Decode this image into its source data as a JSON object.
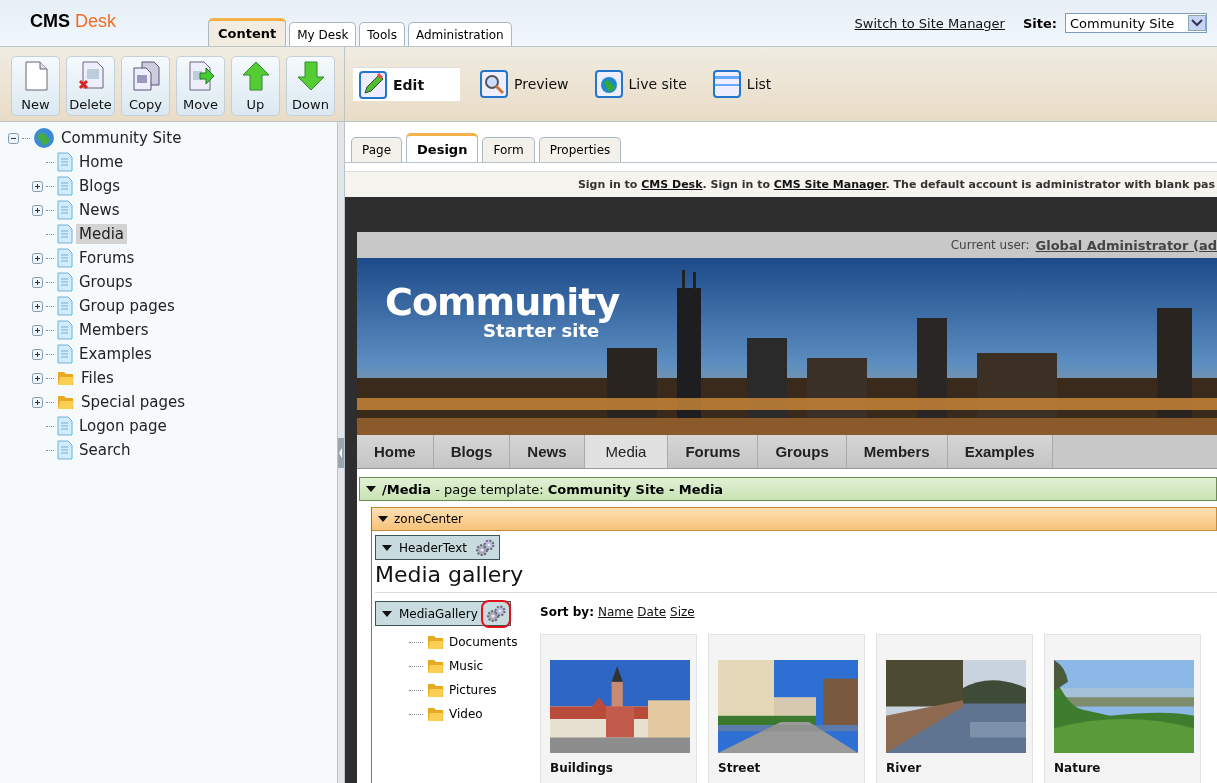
{
  "logo": {
    "main": "CMS",
    "accent": "Desk"
  },
  "main_tabs": [
    {
      "label": "Content",
      "selected": true
    },
    {
      "label": "My Desk",
      "selected": false
    },
    {
      "label": "Tools",
      "selected": false
    },
    {
      "label": "Administration",
      "selected": false
    }
  ],
  "switch_link": "Switch to Site Manager",
  "site_label": "Site:",
  "site_select": "Community Site",
  "toolbar": [
    {
      "label": "New",
      "kind": "new"
    },
    {
      "label": "Delete",
      "kind": "delete"
    },
    {
      "label": "Copy",
      "kind": "copy"
    },
    {
      "label": "Move",
      "kind": "move"
    },
    {
      "label": "Up",
      "kind": "up"
    },
    {
      "label": "Down",
      "kind": "down"
    }
  ],
  "view_modes": [
    {
      "label": "Edit",
      "kind": "edit",
      "selected": true
    },
    {
      "label": "Preview",
      "kind": "preview",
      "selected": false
    },
    {
      "label": "Live site",
      "kind": "live",
      "selected": false
    },
    {
      "label": "List",
      "kind": "list",
      "selected": false
    }
  ],
  "tree": [
    {
      "label": "Community Site",
      "kind": "site",
      "expandable": true,
      "expanded": true,
      "selected": false,
      "children": [
        {
          "label": "Home",
          "kind": "page",
          "expandable": false,
          "selected": false
        },
        {
          "label": "Blogs",
          "kind": "page",
          "expandable": true,
          "selected": false
        },
        {
          "label": "News",
          "kind": "page",
          "expandable": true,
          "selected": false
        },
        {
          "label": "Media",
          "kind": "page",
          "expandable": false,
          "selected": true
        },
        {
          "label": "Forums",
          "kind": "page",
          "expandable": true,
          "selected": false
        },
        {
          "label": "Groups",
          "kind": "page",
          "expandable": true,
          "selected": false
        },
        {
          "label": "Group pages",
          "kind": "page",
          "expandable": true,
          "selected": false
        },
        {
          "label": "Members",
          "kind": "page",
          "expandable": true,
          "selected": false
        },
        {
          "label": "Examples",
          "kind": "page",
          "expandable": true,
          "selected": false
        },
        {
          "label": "Files",
          "kind": "folder",
          "expandable": true,
          "selected": false
        },
        {
          "label": "Special pages",
          "kind": "folder",
          "expandable": true,
          "selected": false
        },
        {
          "label": "Logon page",
          "kind": "page",
          "expandable": false,
          "selected": false
        },
        {
          "label": "Search",
          "kind": "page",
          "expandable": false,
          "selected": false
        }
      ]
    }
  ],
  "page_tabs": [
    {
      "label": "Page",
      "selected": false
    },
    {
      "label": "Design",
      "selected": true
    },
    {
      "label": "Form",
      "selected": false
    },
    {
      "label": "Properties",
      "selected": false
    }
  ],
  "notice": [
    {
      "text": "Sign in to ",
      "link": false
    },
    {
      "text": "CMS Desk",
      "link": true
    },
    {
      "text": ". Sign in to ",
      "link": false
    },
    {
      "text": "CMS Site Manager",
      "link": true
    },
    {
      "text": ". The default account is administrator with blank pas",
      "link": false
    }
  ],
  "site": {
    "current_user_label": "Current user:",
    "current_user": "Global Administrator (ad",
    "banner_title": "Community",
    "banner_subtitle": "Starter site",
    "nav": [
      {
        "label": "Home",
        "selected": false
      },
      {
        "label": "Blogs",
        "selected": false
      },
      {
        "label": "News",
        "selected": false
      },
      {
        "label": "Media",
        "selected": true
      },
      {
        "label": "Forums",
        "selected": false
      },
      {
        "label": "Groups",
        "selected": false
      },
      {
        "label": "Members",
        "selected": false
      },
      {
        "label": "Examples",
        "selected": false
      }
    ],
    "template_bar": "**/Media** - page template: **Community Site - Media**",
    "zone": "zoneCenter",
    "web_parts": [
      {
        "label": "HeaderText",
        "highlighted": false
      },
      {
        "label": "MediaGallery",
        "highlighted": true
      }
    ],
    "heading": "Media gallery",
    "sort_label": "Sort by:",
    "sort_options": [
      "Name",
      "Date",
      "Size"
    ],
    "folders": [
      "Documents",
      "Music",
      "Pictures",
      "Video"
    ],
    "gallery": [
      {
        "caption": "Buildings",
        "kind": "town"
      },
      {
        "caption": "Street",
        "kind": "street"
      },
      {
        "caption": "River",
        "kind": "river"
      },
      {
        "caption": "Nature",
        "kind": "nature"
      }
    ]
  }
}
